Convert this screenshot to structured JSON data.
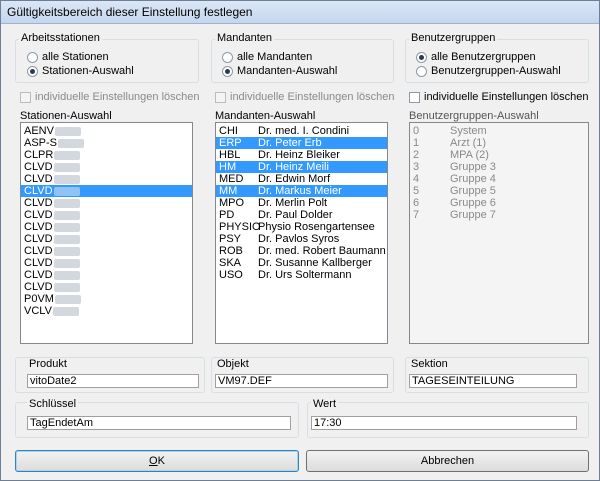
{
  "window": {
    "title": "Gültigkeitsbereich dieser Einstellung festlegen"
  },
  "arbeitsstationen": {
    "group_label": "Arbeitsstationen",
    "radio_all": "alle Stationen",
    "radio_selection": "Stationen-Auswahl",
    "delete_check": "individuelle Einstellungen löschen",
    "list_label": "Stationen-Auswahl",
    "items": [
      "AENV",
      "ASP-S",
      "CLPR",
      "CLVD",
      "CLVD",
      "CLVD",
      "CLVD",
      "CLVD",
      "CLVD",
      "CLVD",
      "CLVD",
      "CLVD",
      "CLVD",
      "CLVD",
      "P0VM",
      "VCLV"
    ]
  },
  "mandanten": {
    "group_label": "Mandanten",
    "radio_all": "alle Mandanten",
    "radio_selection": "Mandanten-Auswahl",
    "delete_check": "individuelle Einstellungen löschen",
    "list_label": "Mandanten-Auswahl",
    "items": [
      {
        "code": "CHI",
        "name": "Dr. med. I. Condini"
      },
      {
        "code": "ERP",
        "name": "Dr. Peter Erb"
      },
      {
        "code": "HBL",
        "name": "Dr. Heinz Bleiker"
      },
      {
        "code": "HM",
        "name": "Dr. Heinz Meili"
      },
      {
        "code": "MED",
        "name": "Dr. Edwin Morf"
      },
      {
        "code": "MM",
        "name": "Dr. Markus Meier"
      },
      {
        "code": "MPO",
        "name": "Dr. Merlin Polt"
      },
      {
        "code": "PD",
        "name": "Dr. Paul Dolder"
      },
      {
        "code": "PHYSIO",
        "name": "Physio Rosengartensee"
      },
      {
        "code": "PSY",
        "name": "Dr. Pavlos Syros"
      },
      {
        "code": "ROB",
        "name": "Dr. med. Robert Baumann"
      },
      {
        "code": "SKA",
        "name": "Dr. Susanne Kallberger"
      },
      {
        "code": "USO",
        "name": "Dr. Urs Soltermann"
      }
    ]
  },
  "benutzergruppen": {
    "group_label": "Benutzergruppen",
    "radio_all": "alle Benutzergruppen",
    "radio_selection": "Benutzergruppen-Auswahl",
    "delete_check": "individuelle Einstellungen löschen",
    "list_label": "Benutzergruppen-Auswahl",
    "items": [
      {
        "code": "0",
        "name": "System"
      },
      {
        "code": "1",
        "name": "Arzt (1)"
      },
      {
        "code": "2",
        "name": "MPA (2)"
      },
      {
        "code": "3",
        "name": "Gruppe 3"
      },
      {
        "code": "4",
        "name": "Gruppe 4"
      },
      {
        "code": "5",
        "name": "Gruppe 5"
      },
      {
        "code": "6",
        "name": "Gruppe 6"
      },
      {
        "code": "7",
        "name": "Gruppe 7"
      }
    ]
  },
  "fields": {
    "produkt_label": "Produkt",
    "produkt_value": "vitoDate2",
    "objekt_label": "Objekt",
    "objekt_value": "VM97.DEF",
    "sektion_label": "Sektion",
    "sektion_value": "TAGESEINTEILUNG",
    "schluessel_label": "Schlüssel",
    "schluessel_value": "TagEndetAm",
    "wert_label": "Wert",
    "wert_value": "17:30"
  },
  "buttons": {
    "ok_underline": "O",
    "ok_rest": "K",
    "cancel": "Abbrechen"
  }
}
